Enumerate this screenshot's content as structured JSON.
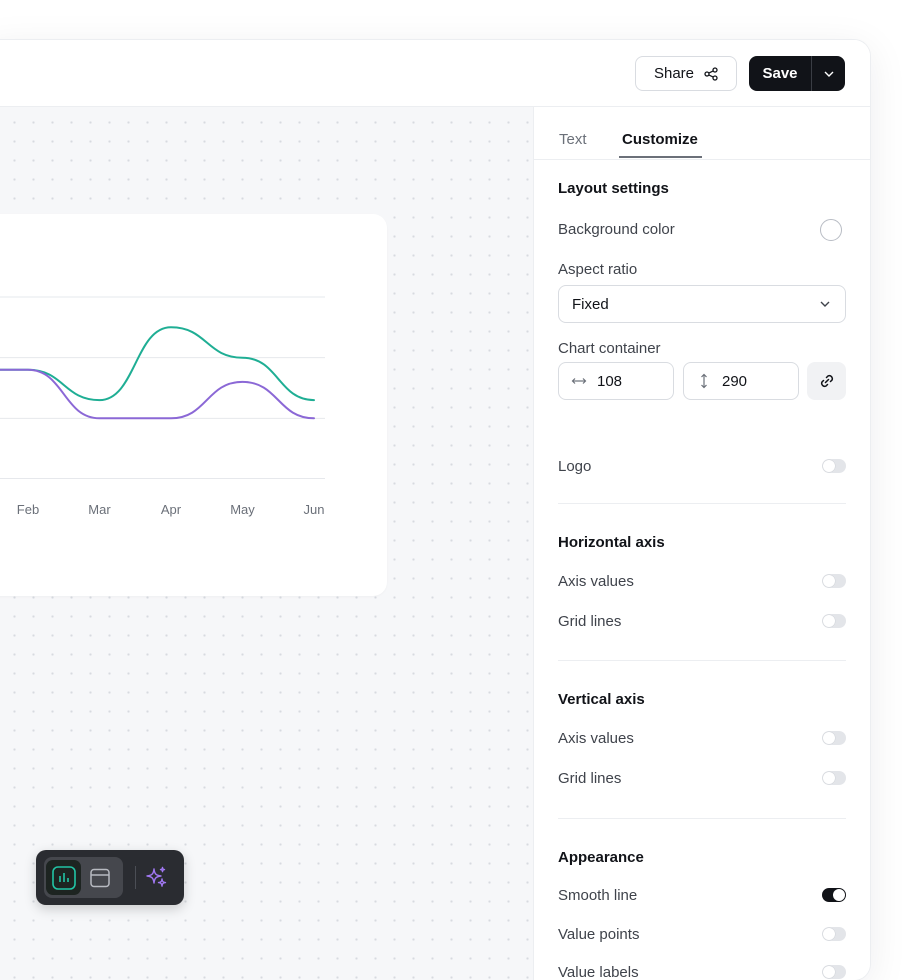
{
  "topbar": {
    "share_label": "Share",
    "save_label": "Save"
  },
  "chart_data": {
    "type": "line",
    "categories": [
      "Feb",
      "Mar",
      "Apr",
      "May",
      "Jun"
    ],
    "series": [
      {
        "color": "#1fae94",
        "values": [
          1.8,
          1.3,
          2.5,
          2.0,
          1.3
        ]
      },
      {
        "color": "#8b68d6",
        "values": [
          1.8,
          1.0,
          1.0,
          1.6,
          1.0
        ]
      }
    ],
    "ylim": [
      0,
      3
    ],
    "grid": true,
    "smooth": true
  },
  "panel": {
    "tabs": [
      {
        "label": "Text",
        "active": false
      },
      {
        "label": "Customize",
        "active": true
      }
    ],
    "layout": {
      "title": "Layout settings",
      "background_color_label": "Background color",
      "aspect_ratio_label": "Aspect ratio",
      "aspect_ratio_value": "Fixed",
      "chart_container_label": "Chart container",
      "width_value": "108",
      "height_value": "290",
      "logo_label": "Logo"
    },
    "horizontal_axis": {
      "title": "Horizontal axis",
      "axis_values_label": "Axis values",
      "grid_lines_label": "Grid lines"
    },
    "vertical_axis": {
      "title": "Vertical axis",
      "axis_values_label": "Axis values",
      "grid_lines_label": "Grid lines"
    },
    "appearance": {
      "title": "Appearance",
      "smooth_line_label": "Smooth line",
      "value_points_label": "Value points",
      "value_labels_label": "Value labels"
    }
  },
  "colors": {
    "accent_teal": "#1fae94",
    "accent_purple": "#8b68d6",
    "dark": "#111318"
  }
}
